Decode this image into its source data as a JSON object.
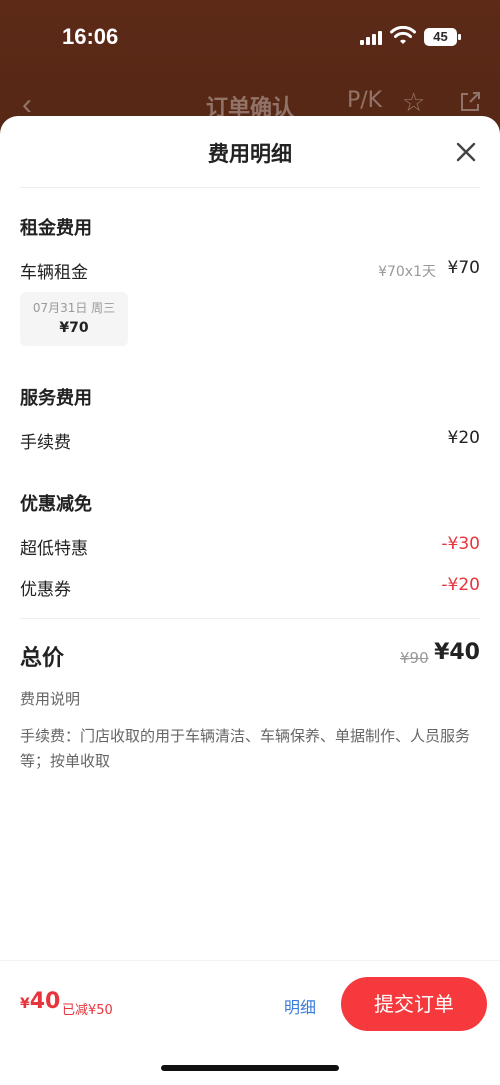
{
  "status_bar": {
    "time": "16:06",
    "battery": "45"
  },
  "nav": {
    "back_icon": "chevron-left-icon",
    "title": "订单确认",
    "pk_label": "P/K",
    "star_icon": "star-icon",
    "share_icon": "share-icon"
  },
  "sheet": {
    "title": "费用明细",
    "close_icon": "close-icon",
    "rental": {
      "title": "租金费用",
      "label": "车辆租金",
      "unit": "¥70x1天",
      "amount": "¥70",
      "chip_date": "07月31日 周三",
      "chip_price": "¥70"
    },
    "service": {
      "title": "服务费用",
      "label": "手续费",
      "amount": "¥20"
    },
    "discount": {
      "title": "优惠减免",
      "items": [
        {
          "label": "超低特惠",
          "amount": "-¥30"
        },
        {
          "label": "优惠券",
          "amount": "-¥20"
        }
      ]
    },
    "total": {
      "label": "总价",
      "original": "¥90",
      "final": "¥40"
    },
    "note": {
      "title": "费用说明",
      "body": "手续费：门店收取的用于车辆清洁、车辆保养、单据制作、人员服务等；按单收取"
    }
  },
  "bottom_bar": {
    "price_currency": "¥",
    "price_value": "40",
    "saved": "已减¥50",
    "detail_label": "明细",
    "submit_label": "提交订单"
  },
  "colors": {
    "accent_red": "#f5393c",
    "link_blue": "#3b7bdc"
  }
}
